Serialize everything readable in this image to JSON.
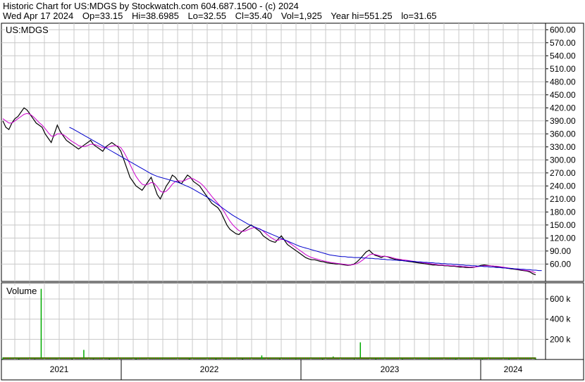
{
  "header": {
    "title": "Historic Chart for US:MDGS by Stockwatch.com 604.687.1500 - (c) 2024",
    "date": "Wed Apr 17 2024",
    "op": "Op=33.15",
    "hi": "Hi=38.6985",
    "lo": "Lo=32.55",
    "cl": "Cl=35.40",
    "vol": "Vol=1,925",
    "year_hi": "Year hi=551.25",
    "year_lo": "lo=31.65"
  },
  "colors": {
    "price": "#000000",
    "ma_short": "#cc00cc",
    "ma_long": "#0000cc",
    "volume_up": "#00aa00",
    "volume_down": "#cc0000",
    "grid": "#c8c8c8"
  },
  "chart_data": [
    {
      "type": "line",
      "label": "US:MDGS",
      "ylim": [
        20,
        615
      ],
      "y_ticks": [
        60,
        90,
        120,
        150,
        180,
        210,
        240,
        270,
        300,
        330,
        360,
        390,
        420,
        450,
        480,
        510,
        540,
        570,
        600
      ],
      "x_labels": [
        "2021",
        "2022",
        "2023",
        "2024"
      ],
      "grid": true,
      "series": [
        {
          "key": "price",
          "values": [
            390,
            375,
            370,
            385,
            395,
            400,
            410,
            420,
            415,
            405,
            395,
            385,
            380,
            375,
            360,
            350,
            340,
            360,
            380,
            365,
            355,
            345,
            340,
            335,
            330,
            325,
            330,
            335,
            340,
            345,
            335,
            330,
            325,
            320,
            330,
            335,
            340,
            335,
            330,
            320,
            300,
            280,
            260,
            250,
            240,
            235,
            230,
            240,
            250,
            260,
            240,
            220,
            210,
            225,
            240,
            250,
            265,
            260,
            250,
            245,
            255,
            265,
            260,
            250,
            245,
            240,
            230,
            220,
            210,
            200,
            195,
            190,
            180,
            165,
            150,
            140,
            135,
            130,
            128,
            135,
            140,
            145,
            150,
            145,
            140,
            135,
            125,
            120,
            115,
            112,
            110,
            118,
            125,
            115,
            105,
            100,
            95,
            90,
            85,
            80,
            75,
            72,
            70,
            70,
            68,
            66,
            65,
            63,
            62,
            61,
            60,
            60,
            59,
            58,
            57,
            58,
            60,
            65,
            72,
            80,
            88,
            92,
            85,
            80,
            78,
            75,
            78,
            77,
            74,
            72,
            70,
            70,
            68,
            67,
            66,
            65,
            64,
            63,
            62,
            61,
            60,
            59,
            58,
            58,
            57,
            57,
            56,
            56,
            55,
            55,
            54,
            53,
            53,
            52,
            52,
            52,
            53,
            55,
            57,
            58,
            57,
            56,
            55,
            54,
            53,
            52,
            51,
            50,
            49,
            48,
            47,
            46,
            45,
            44,
            42,
            38,
            35
          ]
        },
        {
          "key": "ma_short",
          "values": [
            395,
            390,
            385,
            385,
            390,
            395,
            400,
            405,
            407,
            405,
            400,
            393,
            386,
            380,
            372,
            363,
            355,
            355,
            360,
            360,
            358,
            353,
            347,
            342,
            338,
            333,
            331,
            331,
            333,
            336,
            336,
            334,
            331,
            328,
            328,
            330,
            332,
            333,
            332,
            328,
            318,
            305,
            290,
            275,
            262,
            252,
            244,
            242,
            244,
            248,
            246,
            238,
            228,
            225,
            228,
            235,
            244,
            250,
            252,
            251,
            252,
            256,
            258,
            256,
            252,
            248,
            242,
            234,
            225,
            216,
            208,
            200,
            192,
            182,
            170,
            159,
            150,
            143,
            137,
            135,
            136,
            139,
            142,
            144,
            143,
            141,
            136,
            130,
            124,
            119,
            115,
            115,
            117,
            116,
            112,
            107,
            102,
            97,
            92,
            87,
            82,
            78,
            75,
            73,
            71,
            69,
            67,
            66,
            64,
            63,
            62,
            61,
            60,
            59,
            58,
            58,
            59,
            61,
            65,
            70,
            76,
            81,
            83,
            82,
            80,
            78,
            78,
            77,
            76,
            74,
            72,
            71,
            70,
            69,
            68,
            67,
            66,
            65,
            64,
            63,
            62,
            61,
            60,
            59,
            58,
            58,
            57,
            57,
            56,
            56,
            55,
            55,
            54,
            54,
            53,
            53,
            53,
            54,
            55,
            56,
            56,
            56,
            55,
            55,
            54,
            53,
            52,
            51,
            50,
            49,
            48,
            47,
            46,
            45,
            44,
            42,
            40
          ]
        },
        {
          "key": "ma_long",
          "start_index": 22,
          "values": [
            375,
            372,
            368,
            364,
            360,
            356,
            352,
            348,
            344,
            340,
            336,
            332,
            328,
            324,
            320,
            316,
            312,
            308,
            304,
            300,
            296,
            292,
            288,
            284,
            280,
            276,
            272,
            268,
            265,
            262,
            260,
            258,
            256,
            254,
            252,
            250,
            248,
            245,
            242,
            239,
            236,
            232,
            228,
            224,
            220,
            216,
            212,
            207,
            202,
            197,
            192,
            187,
            182,
            177,
            172,
            168,
            164,
            160,
            156,
            152,
            149,
            146,
            143,
            140,
            137,
            134,
            131,
            128,
            125,
            122,
            119,
            116,
            113,
            110,
            107,
            104,
            101,
            99,
            97,
            95,
            93,
            91,
            89,
            87,
            85,
            83,
            81,
            80,
            79,
            78,
            77,
            77,
            76,
            76,
            75,
            75,
            75,
            74,
            74,
            73,
            73,
            72,
            72,
            71,
            71,
            70,
            70,
            69,
            69,
            68,
            68,
            67,
            67,
            66,
            66,
            65,
            65,
            64,
            64,
            63,
            63,
            62,
            62,
            61,
            61,
            60,
            60,
            59,
            59,
            58,
            58,
            57,
            57,
            56,
            56,
            55,
            55,
            54,
            54,
            53,
            53,
            52,
            52,
            51,
            51,
            50,
            50,
            49,
            49,
            48,
            48,
            47,
            47,
            46,
            46,
            45,
            45
          ]
        }
      ]
    },
    {
      "type": "bar",
      "label": "Volume",
      "ylim": [
        0,
        760000
      ],
      "y_ticks": [
        200000,
        400000,
        600000
      ],
      "y_tick_labels": [
        "200 k",
        "400 k",
        "600 k"
      ],
      "bars": [
        {
          "t": 0.0,
          "v": 2000
        },
        {
          "t": 0.03,
          "v": 3000
        },
        {
          "t": 0.06,
          "v": 5000
        },
        {
          "t": 0.072,
          "v": 700000
        },
        {
          "t": 0.08,
          "v": 8000
        },
        {
          "t": 0.1,
          "v": 6000
        },
        {
          "t": 0.13,
          "v": 4000
        },
        {
          "t": 0.152,
          "v": 95000
        },
        {
          "t": 0.17,
          "v": 5000
        },
        {
          "t": 0.2,
          "v": 3000
        },
        {
          "t": 0.25,
          "v": 2500
        },
        {
          "t": 0.3,
          "v": 4000
        },
        {
          "t": 0.35,
          "v": 3000
        },
        {
          "t": 0.4,
          "v": 2000
        },
        {
          "t": 0.45,
          "v": 3000
        },
        {
          "t": 0.486,
          "v": 40000
        },
        {
          "t": 0.52,
          "v": 2000
        },
        {
          "t": 0.55,
          "v": 1500
        },
        {
          "t": 0.6,
          "v": 2000
        },
        {
          "t": 0.62,
          "v": 30000
        },
        {
          "t": 0.66,
          "v": 3000
        },
        {
          "t": 0.671,
          "v": 170000
        },
        {
          "t": 0.7,
          "v": 2000
        },
        {
          "t": 0.75,
          "v": 1500
        },
        {
          "t": 0.8,
          "v": 1500
        },
        {
          "t": 0.85,
          "v": 1200
        },
        {
          "t": 0.9,
          "v": 1000
        },
        {
          "t": 0.95,
          "v": 1000
        },
        {
          "t": 1.0,
          "v": 1925
        }
      ]
    }
  ]
}
